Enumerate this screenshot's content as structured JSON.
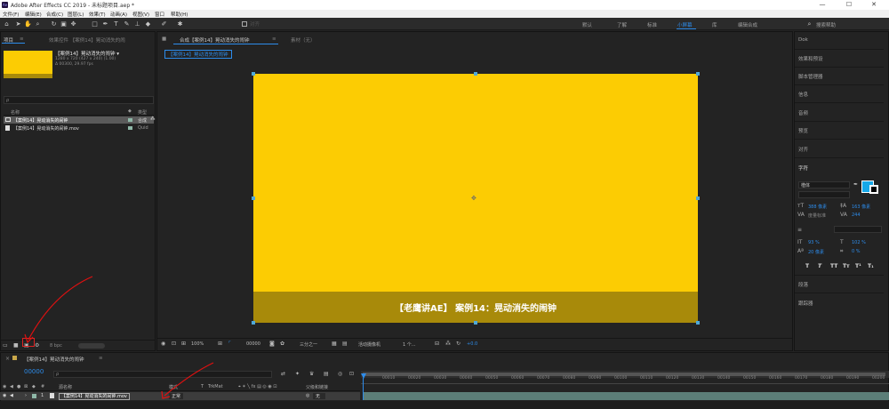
{
  "window": {
    "title": "Adobe After Effects CC 2019 - 未标题项目.aep *",
    "app_badge": "Ae",
    "minimize_icon": "—",
    "maximize_icon": "☐",
    "close_icon": "✕"
  },
  "menu": [
    "文件(F)",
    "编辑(E)",
    "合成(C)",
    "图层(L)",
    "效果(T)",
    "动画(A)",
    "视图(V)",
    "窗口",
    "帮助(H)"
  ],
  "toolbar": {
    "snap_label": "对齐",
    "workspaces": [
      "默认",
      "了解",
      "标准",
      "小屏幕",
      "库",
      "编辑合成"
    ],
    "active_workspace": "小屏幕",
    "search_placeholder": "搜索帮助"
  },
  "project_panel": {
    "tab_label": "项目",
    "effect_tab": "效果控件 【案例14】晃动消失的闹",
    "comp_name": "【案例14】晃动消失的闹钟 ▾",
    "comp_info1": "1280 x 720 (427 x 240) (1.00)",
    "comp_info2": "Δ 00300, 29.97 fps",
    "search_placeholder": "ρ",
    "columns": {
      "name": "名称",
      "type": "类型"
    },
    "items": [
      {
        "name": "【案例14】晃动消失的闹钟",
        "type": "合成"
      },
      {
        "name": "【案例14】晃动消失的闹钟.mov",
        "type": "Quid"
      }
    ],
    "bpc": "8 bpc"
  },
  "composition_panel": {
    "tab_label": "合成【案例14】晃动消失的闹钟",
    "menu_icon": "≡",
    "footage_tab": "素材（无）",
    "sub_tab": "【案例14】晃动消失的闹钟",
    "caption": "【老鹰讲AE】 案例14：晃动消失的闹钟",
    "frame_color": "#fccc03",
    "caption_bar_color": "#a88a0a",
    "zoom": "100%",
    "timecode": "00000",
    "resolution": "三分之一",
    "camera": "活动摄像机",
    "views": "1 个...",
    "exposure": "+0.0"
  },
  "right_panel": {
    "items": [
      "Dok",
      "效果和预设",
      "脚本管理器",
      "信息",
      "音频",
      "预览",
      "对齐",
      "字符",
      "段落",
      "跟踪器"
    ],
    "font_name": "楷体",
    "font_size": "388 像素",
    "leading": "163 像素",
    "kerning": "度量标准",
    "tracking": "244",
    "vert_scale": "93 %",
    "horiz_scale": "102 %",
    "baseline": "20 像素",
    "tsume": "0 %",
    "style_buttons": [
      "T",
      "T",
      "TT",
      "Tт",
      "T¹",
      "T₁"
    ],
    "fill_color": "#16a8e8"
  },
  "timeline": {
    "tab_label": "【案例14】晃动消失的闹钟",
    "menu_icon": "≡",
    "timecode": "00000",
    "search_placeholder": "ρ",
    "col_num": "#",
    "col_name": "源名称",
    "col_mode": "模式",
    "col_t": "T",
    "col_trkmat": "TrkMat",
    "col_parent": "父级和链接",
    "layer": {
      "num": "1",
      "name": "【案例14】晃动消失的闹钟.mov",
      "mode": "正常",
      "parent": "无"
    },
    "ruler": [
      "00010",
      "00020",
      "00030",
      "00040",
      "00050",
      "00060",
      "00070",
      "00080",
      "00090",
      "00100",
      "00110",
      "00120",
      "00130",
      "00140",
      "00150",
      "00160",
      "00170",
      "00180",
      "00190",
      "00200",
      "00"
    ]
  }
}
